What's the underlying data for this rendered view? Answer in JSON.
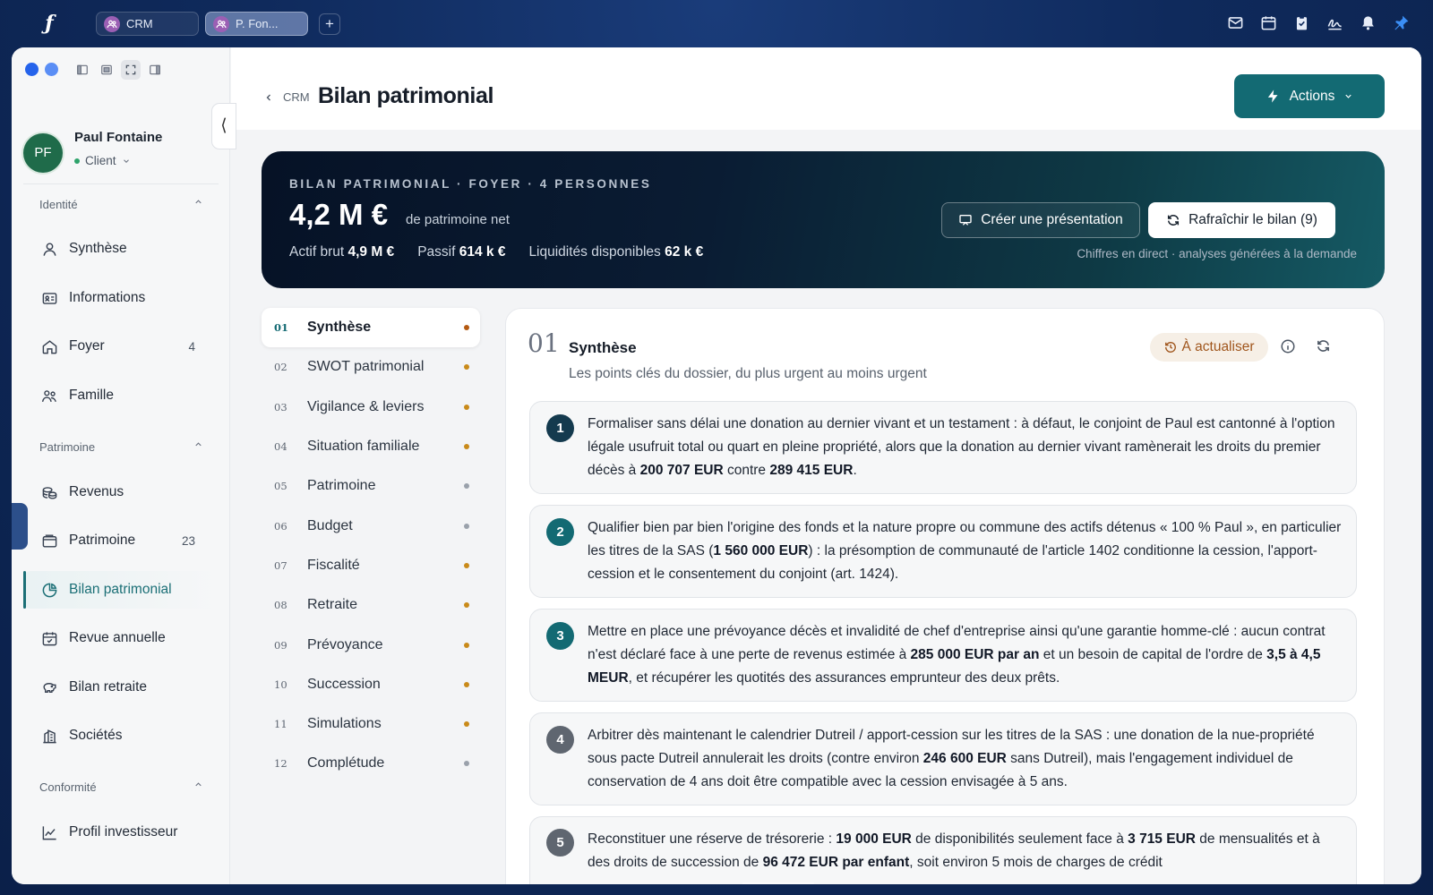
{
  "topbar": {
    "tabs": [
      {
        "label": "CRM"
      },
      {
        "label": "P. Fon..."
      }
    ],
    "new_tab": "+"
  },
  "sidebar": {
    "collapse_glyph": "⟨",
    "profile": {
      "initials": "PF",
      "name": "Paul Fontaine",
      "role": "Client"
    },
    "sections": {
      "identite": "Identité",
      "patrimoine": "Patrimoine",
      "conformite": "Conformité"
    },
    "items": [
      {
        "label": "Synthèse",
        "count": ""
      },
      {
        "label": "Informations",
        "count": ""
      },
      {
        "label": "Foyer",
        "count": "4"
      },
      {
        "label": "Famille",
        "count": ""
      },
      {
        "label": "Revenus",
        "count": ""
      },
      {
        "label": "Patrimoine",
        "count": "23"
      },
      {
        "label": "Bilan patrimonial",
        "count": ""
      },
      {
        "label": "Revue annuelle",
        "count": ""
      },
      {
        "label": "Bilan retraite",
        "count": ""
      },
      {
        "label": "Sociétés",
        "count": ""
      },
      {
        "label": "Profil investisseur",
        "count": ""
      }
    ]
  },
  "header": {
    "breadcrumb": "CRM",
    "title": "Bilan patrimonial",
    "actions_label": "Actions"
  },
  "hero": {
    "kicker": "BILAN PATRIMONIAL · FOYER · 4 PERSONNES",
    "amount": "4,2 M €",
    "amount_sub": "de patrimoine net",
    "stats": [
      {
        "label": "Actif brut",
        "value": "4,9 M €"
      },
      {
        "label": "Passif",
        "value": "614 k €"
      },
      {
        "label": "Liquidités disponibles",
        "value": "62 k €"
      }
    ],
    "btn_present": "Créer une présentation",
    "btn_refresh": "Rafraîchir le bilan (9)",
    "note": "Chiffres en direct · analyses générées à la demande"
  },
  "toc": [
    {
      "num": "01",
      "label": "Synthèse",
      "dot": "#b45a12"
    },
    {
      "num": "02",
      "label": "SWOT patrimonial",
      "dot": "#c98a1a"
    },
    {
      "num": "03",
      "label": "Vigilance & leviers",
      "dot": "#c98a1a"
    },
    {
      "num": "04",
      "label": "Situation familiale",
      "dot": "#c98a1a"
    },
    {
      "num": "05",
      "label": "Patrimoine",
      "dot": "#9aa1ab"
    },
    {
      "num": "06",
      "label": "Budget",
      "dot": "#9aa1ab"
    },
    {
      "num": "07",
      "label": "Fiscalité",
      "dot": "#c98a1a"
    },
    {
      "num": "08",
      "label": "Retraite",
      "dot": "#c98a1a"
    },
    {
      "num": "09",
      "label": "Prévoyance",
      "dot": "#c98a1a"
    },
    {
      "num": "10",
      "label": "Succession",
      "dot": "#c98a1a"
    },
    {
      "num": "11",
      "label": "Simulations",
      "dot": "#c98a1a"
    },
    {
      "num": "12",
      "label": "Complétude",
      "dot": "#9aa1ab"
    }
  ],
  "panel": {
    "num": "01",
    "title": "Synthèse",
    "subtitle": "Les points clés du dossier, du plus urgent au moins urgent",
    "badge": "À actualiser",
    "cards": [
      {
        "n": "1",
        "color": "#143a4e",
        "parts": [
          {
            "t": "Formaliser sans délai une donation au dernier vivant et un testament : à défaut, le conjoint de Paul est cantonné à l'option légale usufruit total ou quart en pleine propriété, alors que la donation au dernier vivant ramènerait les droits du premier décès à "
          },
          {
            "t": "200 707 EUR",
            "b": true
          },
          {
            "t": " contre "
          },
          {
            "t": "289 415 EUR",
            "b": true
          },
          {
            "t": "."
          }
        ]
      },
      {
        "n": "2",
        "color": "#136a73",
        "parts": [
          {
            "t": "Qualifier bien par bien l'origine des fonds et la nature propre ou commune des actifs détenus « 100 % Paul », en particulier les titres de la SAS ("
          },
          {
            "t": "1 560 000 EUR",
            "b": true
          },
          {
            "t": ") : la présomption de communauté de l'article 1402 conditionne la cession, l'apport-cession et le consentement du conjoint (art. 1424)."
          }
        ]
      },
      {
        "n": "3",
        "color": "#136a73",
        "parts": [
          {
            "t": "Mettre en place une prévoyance décès et invalidité de chef d'entreprise ainsi qu'une garantie homme-clé : aucun contrat n'est déclaré face à une perte de revenus estimée à "
          },
          {
            "t": "285 000 EUR par an",
            "b": true
          },
          {
            "t": " et un besoin de capital de l'ordre de "
          },
          {
            "t": "3,5 à 4,5 MEUR",
            "b": true
          },
          {
            "t": ", et récupérer les quotités des assurances emprunteur des deux prêts."
          }
        ]
      },
      {
        "n": "4",
        "color": "#5f6670",
        "parts": [
          {
            "t": "Arbitrer dès maintenant le calendrier Dutreil / apport-cession sur les titres de la SAS : une donation de la nue-propriété sous pacte Dutreil annulerait les droits (contre environ "
          },
          {
            "t": "246 600 EUR",
            "b": true
          },
          {
            "t": " sans Dutreil), mais l'engagement individuel de conservation de 4 ans doit être compatible avec la cession envisagée à 5 ans."
          }
        ]
      },
      {
        "n": "5",
        "color": "#5f6670",
        "parts": [
          {
            "t": "Reconstituer une réserve de trésorerie : "
          },
          {
            "t": "19 000 EUR",
            "b": true
          },
          {
            "t": " de disponibilités seulement face à "
          },
          {
            "t": "3 715 EUR",
            "b": true
          },
          {
            "t": " de mensualités et à des droits de succession de "
          },
          {
            "t": "96 472 EUR par enfant",
            "b": true
          },
          {
            "t": ", soit environ 5 mois de charges de crédit"
          }
        ]
      }
    ]
  }
}
